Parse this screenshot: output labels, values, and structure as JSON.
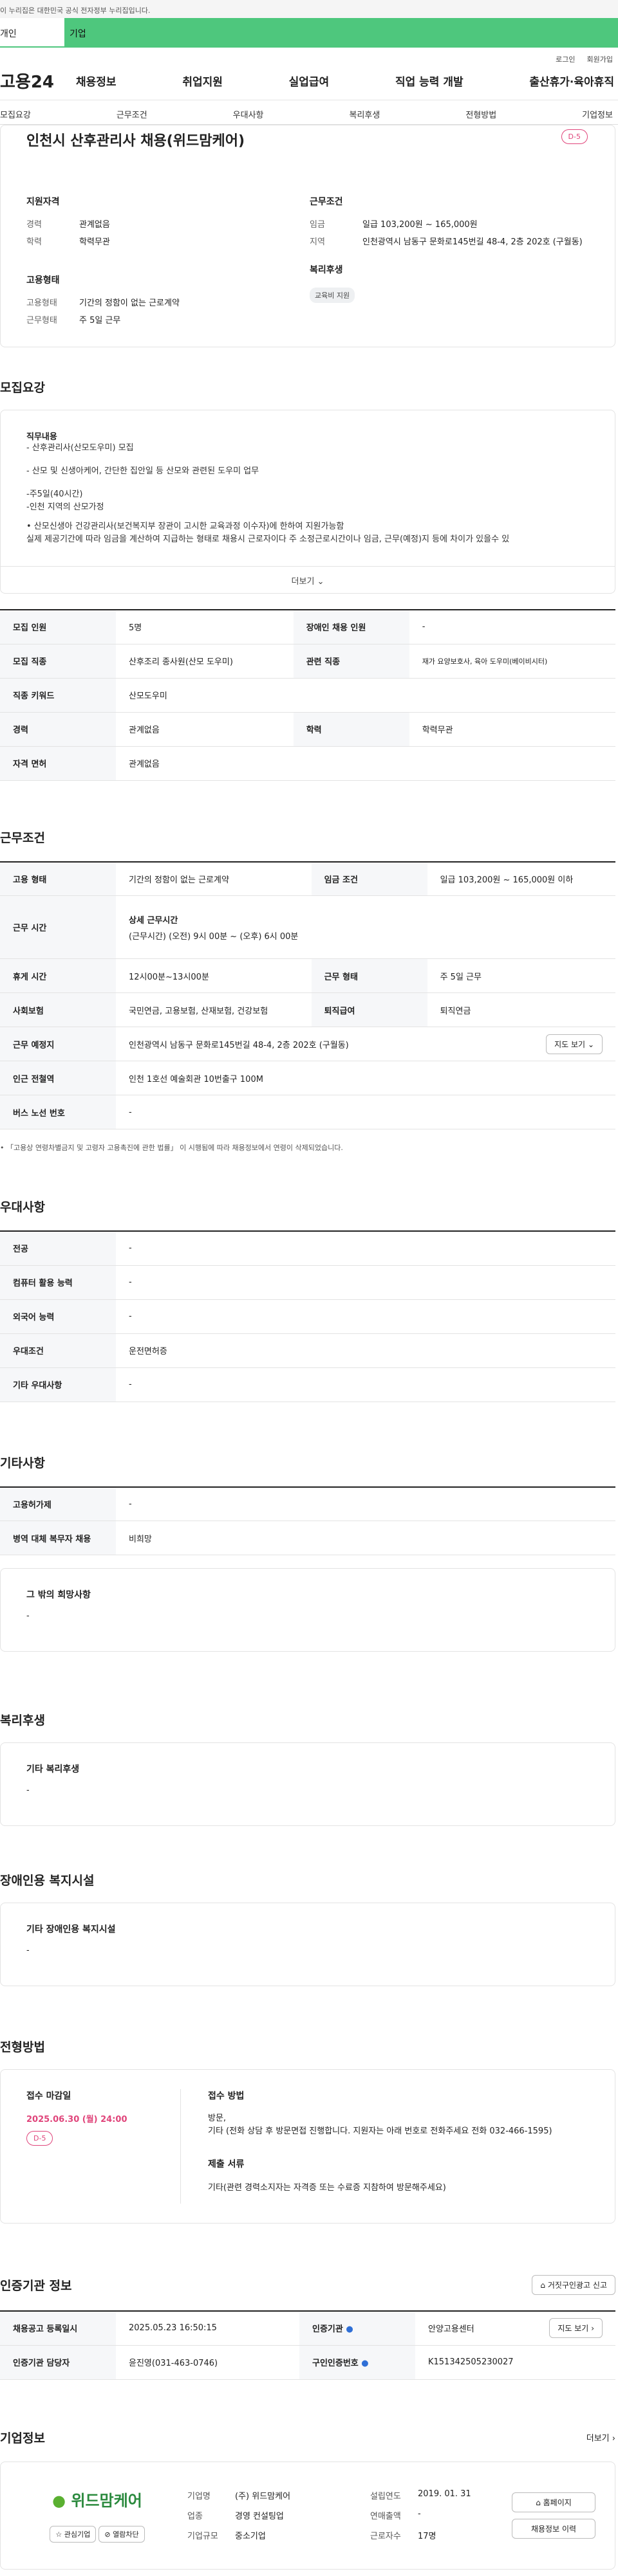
{
  "gov_banner": "이 누리집은 대한민국 공식 전자정부 누리집입니다.",
  "tabs": [
    "개인",
    "기업"
  ],
  "util_links": [
    "로그인",
    "회원가입"
  ],
  "logo": "고용24",
  "gnb": [
    "채용정보",
    "취업지원",
    "실업급여",
    "직업 능력 개발",
    "출산휴가·육아휴직"
  ],
  "subnav": [
    "모집요강",
    "근무조건",
    "우대사항",
    "복리후생",
    "전형방법",
    "기업정보"
  ],
  "summary": {
    "title": "인천시 산후관리사 채용(위드맘케어)",
    "dday": "D-5",
    "qual_heading": "지원자격",
    "career_k": "경력",
    "career_v": "관계없음",
    "edu_k": "학력",
    "edu_v": "학력무관",
    "emp_heading": "고용형태",
    "emp_k1": "고용형태",
    "emp_v1": "기간의 정함이 없는 근로계약",
    "emp_k2": "근무형태",
    "emp_v2": "주 5일 근무",
    "work_heading": "근무조건",
    "wage_k": "임금",
    "wage_v": "일급 103,200원 ~ 165,000원",
    "region_k": "지역",
    "region_v": "인천광역시 남동구 문화로145번길 48-4, 2층 202호 (구월동)",
    "welfare_heading": "복리후생",
    "welfare_chip": "교육비 지원"
  },
  "recruit": {
    "title": "모집요강",
    "duty_heading": "직무내용",
    "duty_lines": [
      "- 산후관리사(산모도우미) 모집",
      "- 산모 및 신생아케어, 간단한 집안일 등 산모와 관련된 도우미 업무",
      "-주5일(40시간)",
      "-인천 지역의 산모가정",
      "• 산모신생아 건강관리사(보건복지부 장관이 고시한 교육과정 이수자)에 한하여 지원가능함",
      "  실제 제공기간에 따라 임금을 계산하여 지급하는 형태로 채용시 근로자이다 주 소정근로시간이나 임금, 근무(예정)지 등에 차이가 있을수 있"
    ],
    "more": "더보기",
    "rows": [
      [
        "모집 인원",
        "5명",
        "장애인 채용 인원",
        "-"
      ],
      [
        "모집 직종",
        "산후조리 종사원(산모 도우미)",
        "관련 직종",
        "재가 요양보호사, 육아 도우미(베이비시터)"
      ],
      [
        "직종 키워드",
        "산모도우미",
        "",
        ""
      ],
      [
        "경력",
        "관계없음",
        "학력",
        "학력무관"
      ],
      [
        "자격 면허",
        "관계없음",
        "",
        ""
      ]
    ]
  },
  "work": {
    "title": "근무조건",
    "emp_type_k": "고용 형태",
    "emp_type_v": "기간의 정함이 없는 근로계약",
    "wage_k": "임금 조건",
    "wage_v": "일급 103,200원 ~ 165,000원 이하",
    "time_k": "근무 시간",
    "time_sub": "상세 근무시간",
    "time_v": "(근무시간) (오전) 9시 00분 ~ (오후) 6시 00분",
    "rest_k": "휴게 시간",
    "rest_v": "12시00분~13시00분",
    "form_k": "근무 형태",
    "form_v": "주 5일 근무",
    "ins_k": "사회보험",
    "ins_v": "국민연금, 고용보험, 산재보험, 건강보험",
    "pension_k": "퇴직급여",
    "pension_v": "퇴직연금",
    "place_k": "근무 예정지",
    "place_v": "인천광역시 남동구 문화로145번길 48-4, 2층 202호 (구월동)",
    "map_btn": "지도 보기",
    "subway_k": "인근 전철역",
    "subway_v": "인천 1호선 예술회관 10번출구 100M",
    "bus_k": "버스 노선 번호",
    "bus_v": "-",
    "note": "「고용상 연령차별금지 및 고령자 고용촉진에 관한 법률」 이 시행됨에 따라 채용정보에서 연령이 삭제되었습니다."
  },
  "pref": {
    "title": "우대사항",
    "rows": [
      [
        "전공",
        "-"
      ],
      [
        "컴퓨터 활용 능력",
        "-"
      ],
      [
        "외국어 능력",
        "-"
      ],
      [
        "우대조건",
        "운전면허증"
      ],
      [
        "기타 우대사항",
        "-"
      ]
    ]
  },
  "etc": {
    "title": "기타사항",
    "rows": [
      [
        "고용허가제",
        "-"
      ],
      [
        "병역 대체 복무자 채용",
        "비희망"
      ]
    ],
    "hope_heading": "그 밖의 희망사항",
    "hope_v": "-"
  },
  "welfare": {
    "title": "복리후생",
    "heading": "기타 복리후생",
    "v": "-"
  },
  "disabled": {
    "title": "장애인용 복지시설",
    "heading": "기타 장애인용 복지시설",
    "v": "-"
  },
  "selection": {
    "title": "전형방법",
    "deadline_heading": "접수 마감일",
    "deadline_v": "2025.06.30 (월) 24:00",
    "dday": "D-5",
    "method_heading": "접수 방법",
    "method_v1": "방문,",
    "method_v2": "기타 (전화 상담 후 방문면접 진행합니다. 지원자는 아래 번호로 전화주세요 전화 032-466-1595)",
    "docs_heading": "제출 서류",
    "docs_v": "기타(관련 경력소지자는 자격증 또는 수료증 지참하여 방문해주세요)"
  },
  "cert": {
    "title": "인증기관 정보",
    "report_btn": "거짓구인광고 신고",
    "reg_k": "채용공고 등록일시",
    "reg_v": "2025.05.23 16:50:15",
    "org_k": "인증기관",
    "org_v": "안양고용센터",
    "map_btn": "지도 보기",
    "mgr_k": "인증기관 담당자",
    "mgr_v": "윤진영(031-463-0746)",
    "num_k": "구인인증번호",
    "num_v": "K151342505230027"
  },
  "company": {
    "title": "기업정보",
    "more": "더보기",
    "logo_text": "위드맘케어",
    "fav_btn": "관심기업",
    "block_btn": "열람차단",
    "name_k": "기업명",
    "name_v": "(주) 위드맘케어",
    "year_k": "설립연도",
    "year_v": "2019. 01. 31",
    "biz_k": "업종",
    "biz_v": "경영 컨설팅업",
    "sales_k": "연매출액",
    "sales_v": "-",
    "size_k": "기업규모",
    "size_v": "중소기업",
    "emp_k": "근로자수",
    "emp_v": "17명",
    "home_btn": "홈페이지",
    "history_btn": "채용정보 이력"
  }
}
